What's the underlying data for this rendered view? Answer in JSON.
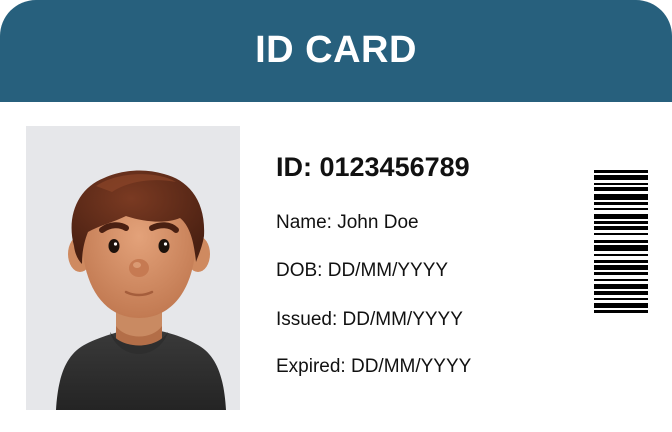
{
  "card": {
    "title": "ID CARD",
    "id_label": "ID: 0123456789",
    "name": "Name: John Doe",
    "dob": "DOB: DD/MM/YYYY",
    "issued": "Issued: DD/MM/YYYY",
    "expired": "Expired: DD/MM/YYYY"
  },
  "colors": {
    "header": "#27607d",
    "photo_background": "#e6e7ea",
    "text": "#111111"
  },
  "photo": {
    "icon": "person-avatar-icon"
  },
  "barcode": {
    "icon": "barcode-icon"
  }
}
